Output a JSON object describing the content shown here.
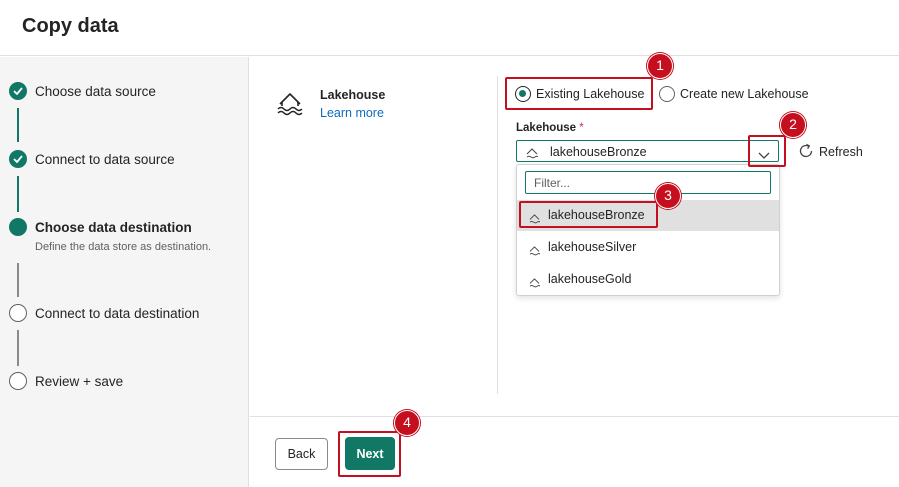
{
  "header": {
    "title": "Copy data"
  },
  "steps": [
    {
      "label": "Choose data source",
      "state": "completed"
    },
    {
      "label": "Connect to data source",
      "state": "completed"
    },
    {
      "label": "Choose data destination",
      "state": "current",
      "description": "Define the data store as destination."
    },
    {
      "label": "Connect to data destination",
      "state": "pending"
    },
    {
      "label": "Review + save",
      "state": "pending"
    }
  ],
  "destination": {
    "name": "Lakehouse",
    "link": "Learn more",
    "icon": "lakehouse-icon"
  },
  "radio": {
    "existing_label": "Existing Lakehouse",
    "new_label": "Create new Lakehouse",
    "selected": "existing"
  },
  "lakehouse_field": {
    "label": "Lakehouse",
    "required_mark": "*",
    "value": "lakehouseBronze",
    "refresh_label": "Refresh",
    "filter_placeholder": "Filter...",
    "options": [
      "lakehouseBronze",
      "lakehouseSilver",
      "lakehouseGold"
    ]
  },
  "footer": {
    "back_label": "Back",
    "next_label": "Next"
  },
  "callouts": [
    "1",
    "2",
    "3",
    "4"
  ],
  "colors": {
    "accent": "#117865",
    "callout": "#c50f1f",
    "link": "#0f6cbd"
  }
}
